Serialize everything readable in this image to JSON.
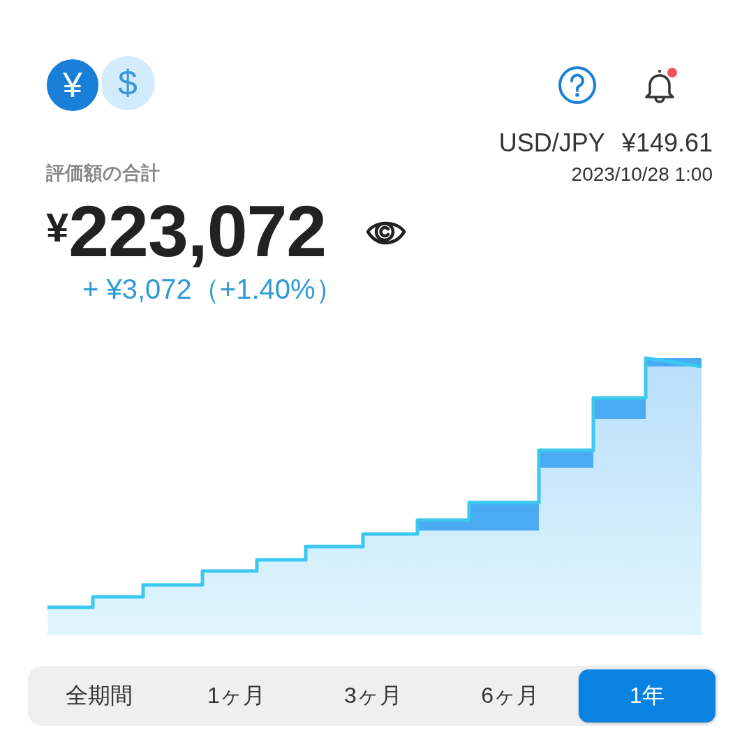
{
  "currency_toggle": [
    {
      "symbol": "¥",
      "selected": true
    },
    {
      "symbol": "$",
      "selected": false
    }
  ],
  "exchange_rate": {
    "pair": "USD/JPY",
    "rate": "¥149.61",
    "timestamp": "2023/10/28 1:00"
  },
  "notifications": {
    "unread": true
  },
  "total": {
    "label": "評価額の合計",
    "currency": "¥",
    "amount": "223,072",
    "change": "+ ¥3,072（+1.40%）"
  },
  "periods": [
    {
      "label": "全期間",
      "selected": false
    },
    {
      "label": "1ヶ月",
      "selected": false
    },
    {
      "label": "3ヶ月",
      "selected": false
    },
    {
      "label": "6ヶ月",
      "selected": false
    },
    {
      "label": "1年",
      "selected": true
    }
  ]
}
